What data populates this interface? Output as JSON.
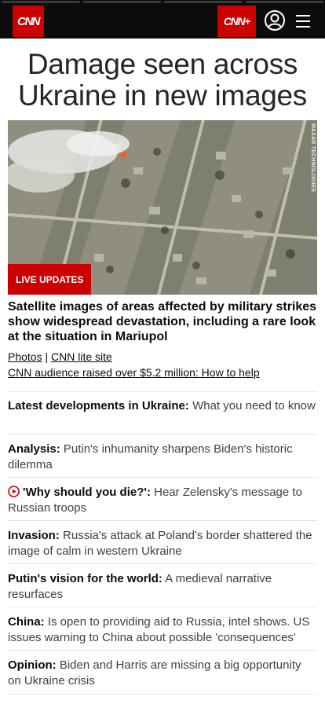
{
  "header": {
    "logo_text": "CNN",
    "cnnplus_text": "CNN+",
    "user_icon": "user-account-icon",
    "menu_icon": "hamburger-menu-icon"
  },
  "headline": "Damage seen across Ukraine in new images",
  "hero": {
    "image_credit": "MAXAR TECHNOLOGIES",
    "badge": "LIVE UPDATES"
  },
  "subhead": "Satellite images of areas affected by military strikes show widespread devastation, including a rare look at the situation in Mariupol",
  "links": {
    "photos": "Photos",
    "separator": "|",
    "lite": "CNN lite site",
    "how_to_help": "CNN audience raised over $5.2 million: How to help"
  },
  "stories": [
    {
      "label": "Latest developments in Ukraine:",
      "text": " What you need to know"
    },
    {
      "label": "Analysis:",
      "text": " Putin's inhumanity sharpens Biden's historic dilemma"
    },
    {
      "label": "'Why should you die?':",
      "text": " Hear Zelensky's message to Russian troops"
    },
    {
      "label": "Invasion:",
      "text": " Russia's attack at Poland's border shattered the image of calm in western Ukraine"
    },
    {
      "label": "Putin's vision for the world:",
      "text": " A medieval narrative resurfaces"
    },
    {
      "label": "China:",
      "text": " Is open to providing aid to Russia, intel shows. US issues warning to China about possible 'consequences'"
    },
    {
      "label": "Opinion:",
      "text": " Biden and Harris are missing a big opportunity on Ukraine crisis"
    }
  ],
  "colors": {
    "brand_red": "#cc0000",
    "header_bg": "#0c0c0c"
  },
  "video_icon": "play-circle-icon"
}
